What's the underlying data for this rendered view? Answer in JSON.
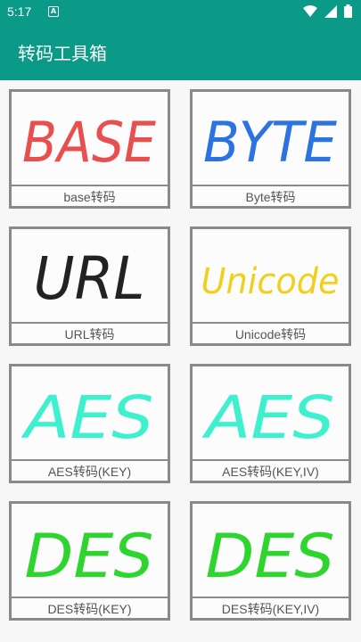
{
  "status_bar": {
    "time": "5:17",
    "notification_badge": "A",
    "icons": [
      "wifi-icon",
      "signal-icon",
      "battery-icon"
    ]
  },
  "app_bar": {
    "title": "转码工具箱",
    "color": "#0b9a88"
  },
  "cards": [
    {
      "art_text": "BASE",
      "art_color": "#e84f4f",
      "label": "base转码"
    },
    {
      "art_text": "BYTE",
      "art_color": "#2a73e0",
      "label": "Byte转码"
    },
    {
      "art_text": "URL",
      "art_color": "#222222",
      "label": "URL转码"
    },
    {
      "art_text": "Unicode",
      "art_color": "#f2cf1d",
      "label": "Unicode转码"
    },
    {
      "art_text": "AES",
      "art_color": "#3ff0cf",
      "label": "AES转码(KEY)"
    },
    {
      "art_text": "AES",
      "art_color": "#3ff0cf",
      "label": "AES转码(KEY,IV)"
    },
    {
      "art_text": "DES",
      "art_color": "#2fd52f",
      "label": "DES转码(KEY)"
    },
    {
      "art_text": "DES",
      "art_color": "#2fd52f",
      "label": "DES转码(KEY,IV)"
    }
  ]
}
